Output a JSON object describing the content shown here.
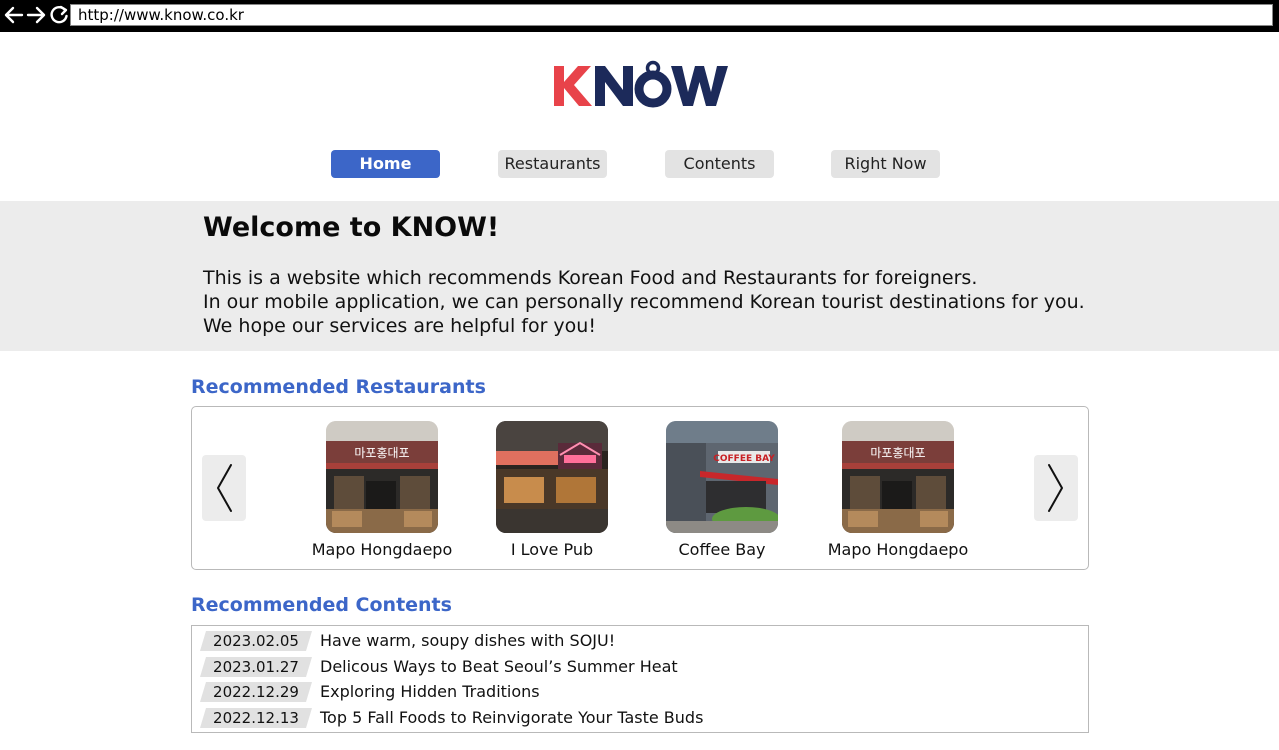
{
  "browser": {
    "url": "http://www.know.co.kr",
    "icons": [
      "back-arrow-icon",
      "forward-arrow-icon",
      "reload-icon"
    ]
  },
  "logo": {
    "text": "KNOW",
    "colors": {
      "k": "#e8434a",
      "now": "#1c2a5a"
    }
  },
  "nav": {
    "items": [
      {
        "label": "Home",
        "active": true
      },
      {
        "label": "Restaurants",
        "active": false
      },
      {
        "label": "Contents",
        "active": false
      },
      {
        "label": "Right Now",
        "active": false
      }
    ]
  },
  "welcome": {
    "title": "Welcome to KNOW!",
    "lines": [
      "This is a website which recommends Korean Food and Restaurants for foreigners.",
      "In our mobile application, we can personally recommend Korean tourist destinations for you.",
      "We hope our services are helpful for you!"
    ]
  },
  "recommended_restaurants": {
    "heading": "Recommended Restaurants",
    "prev_icon": "chevron-left-icon",
    "next_icon": "chevron-right-icon",
    "items": [
      {
        "name": "Mapo Hongdaepo",
        "sign_text": "마포홍대포"
      },
      {
        "name": "I Love Pub",
        "sign_text": ""
      },
      {
        "name": "Coffee Bay",
        "sign_text": "COFFEE BAY"
      },
      {
        "name": "Mapo Hongdaepo",
        "sign_text": "마포홍대포"
      }
    ]
  },
  "recommended_contents": {
    "heading": "Recommended Contents",
    "items": [
      {
        "date": "2023.02.05",
        "title": "Have warm, soupy dishes with SOJU!"
      },
      {
        "date": "2023.01.27",
        "title": "Delicous Ways to Beat Seoul’s Summer Heat"
      },
      {
        "date": "2022.12.29",
        "title": "Exploring Hidden Traditions"
      },
      {
        "date": "2022.12.13",
        "title": "Top 5 Fall Foods to Reinvigorate Your Taste Buds"
      }
    ]
  },
  "colors": {
    "accent": "#3c66c8",
    "nav_inactive": "#e3e3e3",
    "band": "#ececec"
  }
}
